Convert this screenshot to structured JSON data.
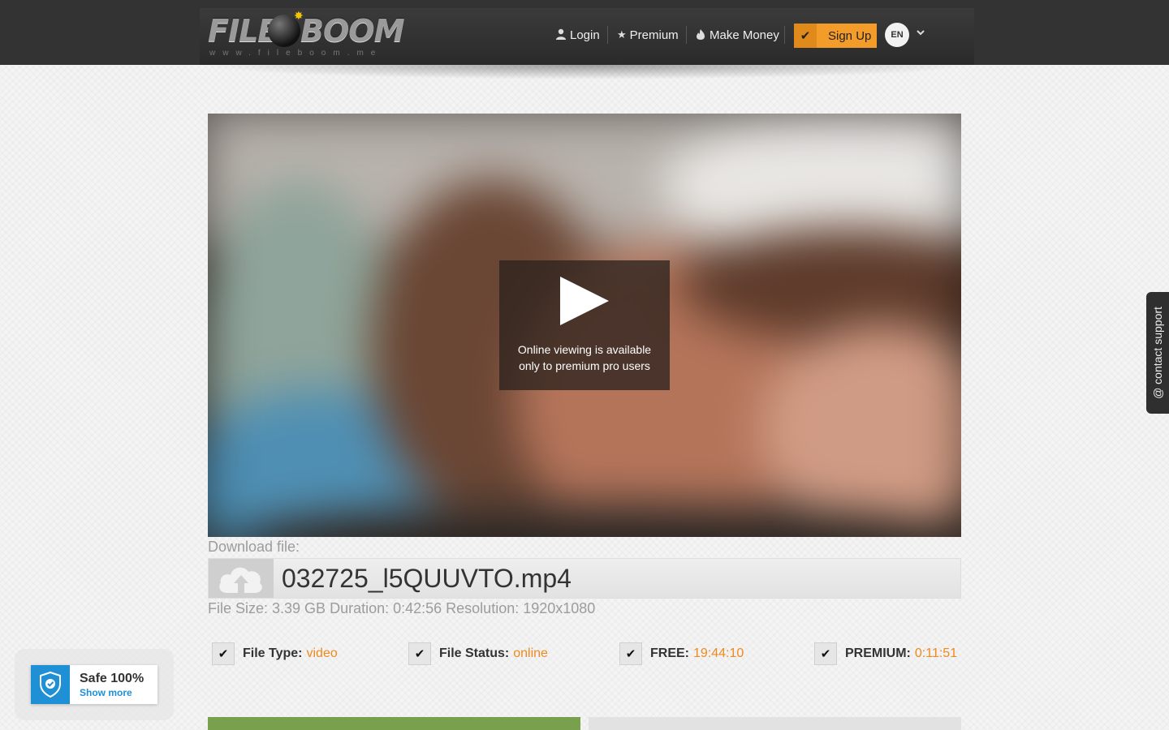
{
  "header": {
    "logo": {
      "word1": "FILE",
      "word2": "BOOM",
      "url": "www.fileboom.me"
    },
    "nav": {
      "login": "Login",
      "premium": "Premium",
      "make_money": "Make Money"
    },
    "signup_label": "Sign Up",
    "language": "EN"
  },
  "player": {
    "message_line1": "Online viewing is available",
    "message_line2": "only to premium pro users"
  },
  "download": {
    "label": "Download file:",
    "filename": "032725_l5QUUVTO.mp4",
    "meta": "File Size: 3.39 GB Duration: 0:42:56 Resolution: 1920x1080"
  },
  "stats": {
    "file_type": {
      "key": "File Type:",
      "value": "video"
    },
    "file_status": {
      "key": "File Status:",
      "value": "online"
    },
    "free": {
      "key": "FREE:",
      "value": "19:44:10"
    },
    "premium": {
      "key": "PREMIUM:",
      "value": "0:11:51"
    }
  },
  "safe_badge": {
    "title": "Safe 100%",
    "link": "Show more"
  },
  "support_tab": "@ contact support",
  "colors": {
    "accent_orange": "#f39c2a",
    "value_orange": "#f0891e",
    "safe_blue": "#1f8fd6",
    "header_dark": "#333333"
  },
  "icons": [
    "user-icon",
    "star-icon",
    "flame-icon",
    "check-icon",
    "chevron-down-icon",
    "play-icon",
    "cloud-upload-icon",
    "shield-check-icon"
  ]
}
